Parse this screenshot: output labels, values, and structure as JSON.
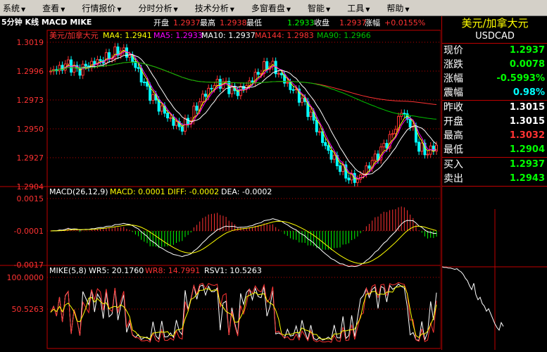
{
  "menu": [
    {
      "label": "系统",
      "key": "S"
    },
    {
      "label": "查看",
      "key": "V"
    },
    {
      "label": "行情报价",
      "key": "R"
    },
    {
      "label": "分时分析",
      "key": "F"
    },
    {
      "label": "技术分析",
      "key": "T"
    },
    {
      "label": "多窗看盘",
      "key": "W"
    },
    {
      "label": "智能",
      "key": "A"
    },
    {
      "label": "工具",
      "key": "O"
    },
    {
      "label": "帮助",
      "key": "H"
    }
  ],
  "chart_title": "5分钟 K线 MACD MIKE",
  "ohlc_header": {
    "open_label": "开盘",
    "open": "1.2937",
    "high_label": "最高",
    "high": "1.2938",
    "low_label": "最低",
    "low": "1.2933",
    "close_label": "收盘",
    "close": "1.2937",
    "change_label": "涨幅",
    "change": "+0.0155%"
  },
  "price_panel": {
    "name": "美元/加拿大元",
    "ma": [
      {
        "label": "MA4: 1.2941",
        "color": "#ffff00"
      },
      {
        "label": "MA5: 1.2933",
        "color": "#ff00ff"
      },
      {
        "label": "MA10: 1.2937",
        "color": "#ffffff"
      },
      {
        "label": "MA144: 1.2983",
        "color": "#ff3232"
      },
      {
        "label": "MA90: 1.2966",
        "color": "#00c000"
      }
    ],
    "y_ticks": [
      "1.3019",
      "1.2996",
      "1.2973",
      "1.2950",
      "1.2927",
      "1.2904"
    ]
  },
  "macd_panel": {
    "params": "MACD(26,12,9)",
    "macd": "MACD: 0.0001",
    "diff": "DIFF: -0.0002",
    "dea": "DEA: -0.0002",
    "y_ticks": [
      "0.0015",
      "-0.0001",
      "-0.0017"
    ]
  },
  "mike_panel": {
    "params": "MIKE(5,8)",
    "wr5": "WR5: 20.1760",
    "wr8": "WR8: 14.7991",
    "rsv1": "RSV1: 10.5263",
    "y_ticks": [
      "100.0000",
      "50.5263"
    ]
  },
  "quote": {
    "title": "美元/加拿大元",
    "code": "USDCAD",
    "rows": [
      {
        "label": "现价",
        "value": "1.2937",
        "color": "green"
      },
      {
        "label": "涨跌",
        "value": "0.0078",
        "color": "green"
      },
      {
        "label": "涨幅",
        "value": "-0.5993%",
        "color": "green"
      },
      {
        "label": "震幅",
        "value": "0.98%",
        "color": "cyan"
      },
      {
        "label": "昨收",
        "value": "1.3015",
        "color": "white"
      },
      {
        "label": "开盘",
        "value": "1.3015",
        "color": "white"
      },
      {
        "label": "最高",
        "value": "1.3032",
        "color": "red"
      },
      {
        "label": "最低",
        "value": "1.2904",
        "color": "green"
      },
      {
        "label": "买入",
        "value": "1.2937",
        "color": "green"
      },
      {
        "label": "卖出",
        "value": "1.2943",
        "color": "green"
      }
    ]
  },
  "chart_data": {
    "type": "line",
    "title": "5分钟 K线 MACD MIKE",
    "ylabel": "",
    "ylim": [
      1.2904,
      1.3019
    ],
    "series": [
      {
        "name": "美元/加拿大元",
        "values": [
          1.2996,
          1.2998,
          1.3001,
          1.2995,
          1.2999,
          1.3003,
          1.3006,
          1.301,
          1.3014,
          1.3008,
          1.2995,
          1.298,
          1.297,
          1.2962,
          1.2955,
          1.2952,
          1.296,
          1.2973,
          1.2981,
          1.2986,
          1.2984,
          1.2978,
          1.2982,
          1.299,
          1.2998,
          1.3003,
          1.2995,
          1.2985,
          1.2978,
          1.2968,
          1.2955,
          1.294,
          1.2929,
          1.292,
          1.2912,
          1.291,
          1.2918,
          1.2926,
          1.2935,
          1.2945,
          1.2964,
          1.2955,
          1.2936,
          1.2932,
          1.2937
        ]
      }
    ]
  }
}
